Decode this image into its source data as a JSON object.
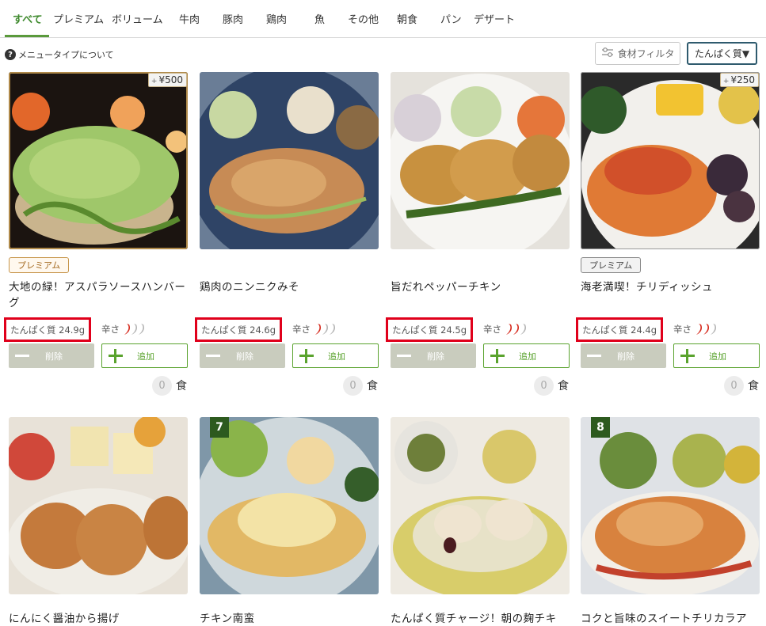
{
  "tabs": [
    {
      "label": "すべて",
      "active": true
    },
    {
      "label": "プレミアム"
    },
    {
      "label": "ボリューム"
    },
    {
      "label": "牛肉"
    },
    {
      "label": "豚肉"
    },
    {
      "label": "鶏肉"
    },
    {
      "label": "魚"
    },
    {
      "label": "その他"
    },
    {
      "label": "朝食"
    },
    {
      "label": "パン"
    },
    {
      "label": "デザート"
    }
  ],
  "help": {
    "icon": "question-icon",
    "icon_text": "?",
    "text": "メニュータイプについて"
  },
  "filter": {
    "label": "食材フィルタ",
    "icon": "sliders-icon"
  },
  "sort": {
    "label": "たんぱく質▼"
  },
  "buttons": {
    "delete": "削除",
    "add": "追加"
  },
  "spice_label": "辛さ",
  "unit_label": "食",
  "products": [
    {
      "name": "大地の緑！アスパラソースハンバーグ",
      "tag": "プレミアム",
      "price": "¥500",
      "protein": "たんぱく質 24.9g",
      "spice_level": 1,
      "count": "0"
    },
    {
      "name": "鶏肉のニンニクみそ",
      "tag": "",
      "price": "",
      "protein": "たんぱく質 24.6g",
      "spice_level": 1,
      "count": "0"
    },
    {
      "name": "旨だれペッパーチキン",
      "tag": "",
      "price": "",
      "protein": "たんぱく質 24.5g",
      "spice_level": 2,
      "count": "0"
    },
    {
      "name": "海老満喫！チリディッシュ",
      "tag": "プレミアム",
      "price": "¥250",
      "protein": "たんぱく質 24.4g",
      "spice_level": 2,
      "count": "0"
    }
  ],
  "products_row2": [
    {
      "name": "にんにく醤油から揚げ",
      "badge": ""
    },
    {
      "name": "チキン南蛮",
      "badge": "7"
    },
    {
      "name": "たんぱく質チャージ！朝の麹チキ",
      "badge": ""
    },
    {
      "name": "コクと旨味のスイートチリカラア",
      "badge": "8"
    }
  ],
  "price_plus": "+",
  "colors": {
    "accent": "#5aa32e",
    "active_tab": "#3f8a2e",
    "highlight": "#e0001b",
    "premium_gold": "#c7954a",
    "sort_border": "#2f5b6e",
    "pepper_red": "#d62b1e",
    "pepper_gray": "#b5b5b5"
  }
}
